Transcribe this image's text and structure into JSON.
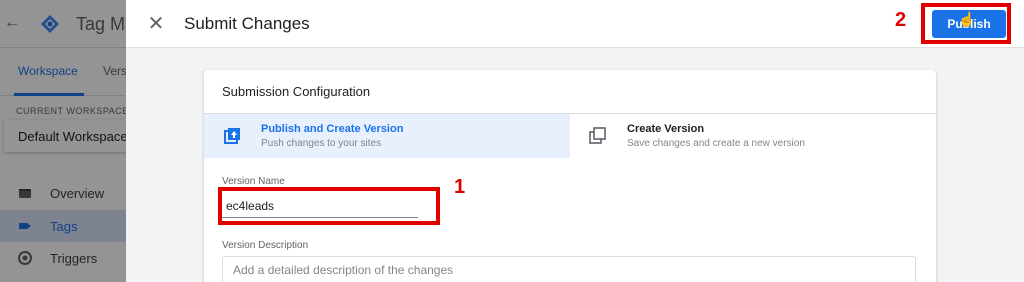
{
  "background_app": {
    "back_glyph": "←",
    "title": "Tag Ma",
    "tabs": [
      {
        "label": "Workspace",
        "active": true
      },
      {
        "label": "Vers",
        "active": false
      }
    ],
    "current_workspace_label": "CURRENT WORKSPACE",
    "workspace_name": "Default Workspace",
    "nav_items": [
      {
        "label": "Overview",
        "icon": "overview-icon",
        "active": false
      },
      {
        "label": "Tags",
        "icon": "tag-icon",
        "active": true
      },
      {
        "label": "Triggers",
        "icon": "trigger-icon",
        "active": false
      }
    ]
  },
  "dialog": {
    "close_glyph": "✕",
    "title": "Submit Changes",
    "publish_label": "Publish",
    "card": {
      "title": "Submission Configuration",
      "options": [
        {
          "title": "Publish and Create Version",
          "subtitle": "Push changes to your sites",
          "icon": "publish-version-icon",
          "selected": true
        },
        {
          "title": "Create Version",
          "subtitle": "Save changes and create a new version",
          "icon": "create-version-icon",
          "selected": false
        }
      ],
      "version_name_label": "Version Name",
      "version_name_value": "ec4leads",
      "version_description_label": "Version Description",
      "version_description_placeholder": "Add a detailed description of the changes"
    }
  },
  "annotations": {
    "step_1": "1",
    "step_2": "2",
    "color": "#e00000"
  },
  "colors": {
    "accent": "#1a73e8",
    "selected_option_bg": "#e8f0fe",
    "overlay": "rgba(0,0,0,0.42)"
  }
}
